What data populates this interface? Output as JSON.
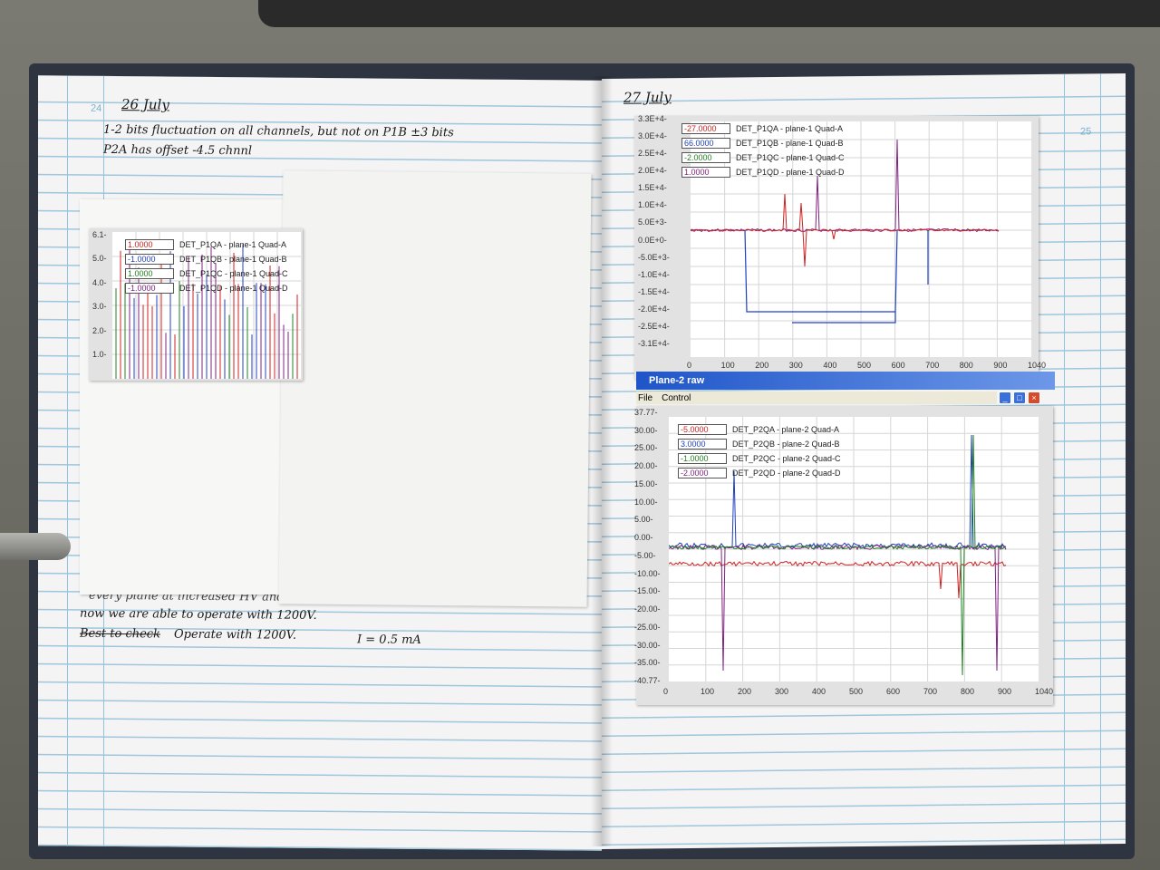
{
  "left_page": {
    "page_number": "24",
    "date": "26 July",
    "notes": [
      "1-2 bits fluctuation on all channels, but not on P1B ±3 bits",
      "P2A has offset -4.5 chnnl"
    ],
    "bottom_notes": {
      "line1": "every plane at increased HV and ... (partly hidden)",
      "line2": "now we are able to operate with 1200V.",
      "line3_struck": "Best to check",
      "line3": "Operate with 1200V.",
      "current": "I = 0.5 mA"
    },
    "small_plot": {
      "legend": [
        {
          "value": "1.0000",
          "name": "DET_P1QA - plane-1 Quad-A",
          "color": "#d02020"
        },
        {
          "value": "-1.0000",
          "name": "DET_P1QB - plane-1 Quad-B",
          "color": "#2040c0"
        },
        {
          "value": "1.0000",
          "name": "DET_P1QC - plane-1 Quad-C",
          "color": "#208020"
        },
        {
          "value": "-1.0000",
          "name": "DET_P1QD - plane-1 Quad-D",
          "color": "#802080"
        }
      ],
      "y_ticks": [
        "6.1-",
        "5.0-",
        "4.0-",
        "3.0-",
        "2.0-",
        "1.0-"
      ]
    }
  },
  "right_page": {
    "page_number": "25",
    "date": "27 July",
    "plot1": {
      "legend": [
        {
          "value": "-27.0000",
          "name": "DET_P1QA - plane-1 Quad-A",
          "color": "#d02020"
        },
        {
          "value": "66.0000",
          "name": "DET_P1QB - plane-1 Quad-B",
          "color": "#2040c0"
        },
        {
          "value": "-2.0000",
          "name": "DET_P1QC - plane-1 Quad-C",
          "color": "#208020"
        },
        {
          "value": "1.0000",
          "name": "DET_P1QD - plane-1 Quad-D",
          "color": "#802080"
        }
      ],
      "y_ticks": [
        "3.3E+4-",
        "3.0E+4-",
        "2.5E+4-",
        "2.0E+4-",
        "1.5E+4-",
        "1.0E+4-",
        "5.0E+3-",
        "0.0E+0-",
        "-5.0E+3-",
        "-1.0E+4-",
        "-1.5E+4-",
        "-2.0E+4-",
        "-2.5E+4-",
        "-3.1E+4-"
      ],
      "x_ticks": [
        "0",
        "100",
        "200",
        "300",
        "400",
        "500",
        "600",
        "700",
        "800",
        "900",
        "1040"
      ]
    },
    "window": {
      "title": "Plane-2 raw",
      "menu": [
        "File",
        "Control"
      ]
    },
    "plot2": {
      "legend": [
        {
          "value": "-5.0000",
          "name": "DET_P2QA - plane-2 Quad-A",
          "color": "#d02020"
        },
        {
          "value": "3.0000",
          "name": "DET_P2QB - plane-2 Quad-B",
          "color": "#2040c0"
        },
        {
          "value": "-1.0000",
          "name": "DET_P2QC - plane-2 Quad-C",
          "color": "#208020"
        },
        {
          "value": "-2.0000",
          "name": "DET_P2QD - plane-2 Quad-D",
          "color": "#802080"
        }
      ],
      "y_ticks": [
        "37.77-",
        "30.00-",
        "25.00-",
        "20.00-",
        "15.00-",
        "10.00-",
        "5.00-",
        "0.00-",
        "-5.00-",
        "-10.00-",
        "-15.00-",
        "-20.00-",
        "-25.00-",
        "-30.00-",
        "-35.00-",
        "-40.77-"
      ],
      "x_ticks": [
        "0",
        "100",
        "200",
        "300",
        "400",
        "500",
        "600",
        "700",
        "800",
        "900",
        "1040"
      ]
    }
  },
  "colors": {
    "series_a": "#d02020",
    "series_b": "#2040c0",
    "series_c": "#208020",
    "series_d": "#802080",
    "ruled_line": "#9fc6dc"
  }
}
